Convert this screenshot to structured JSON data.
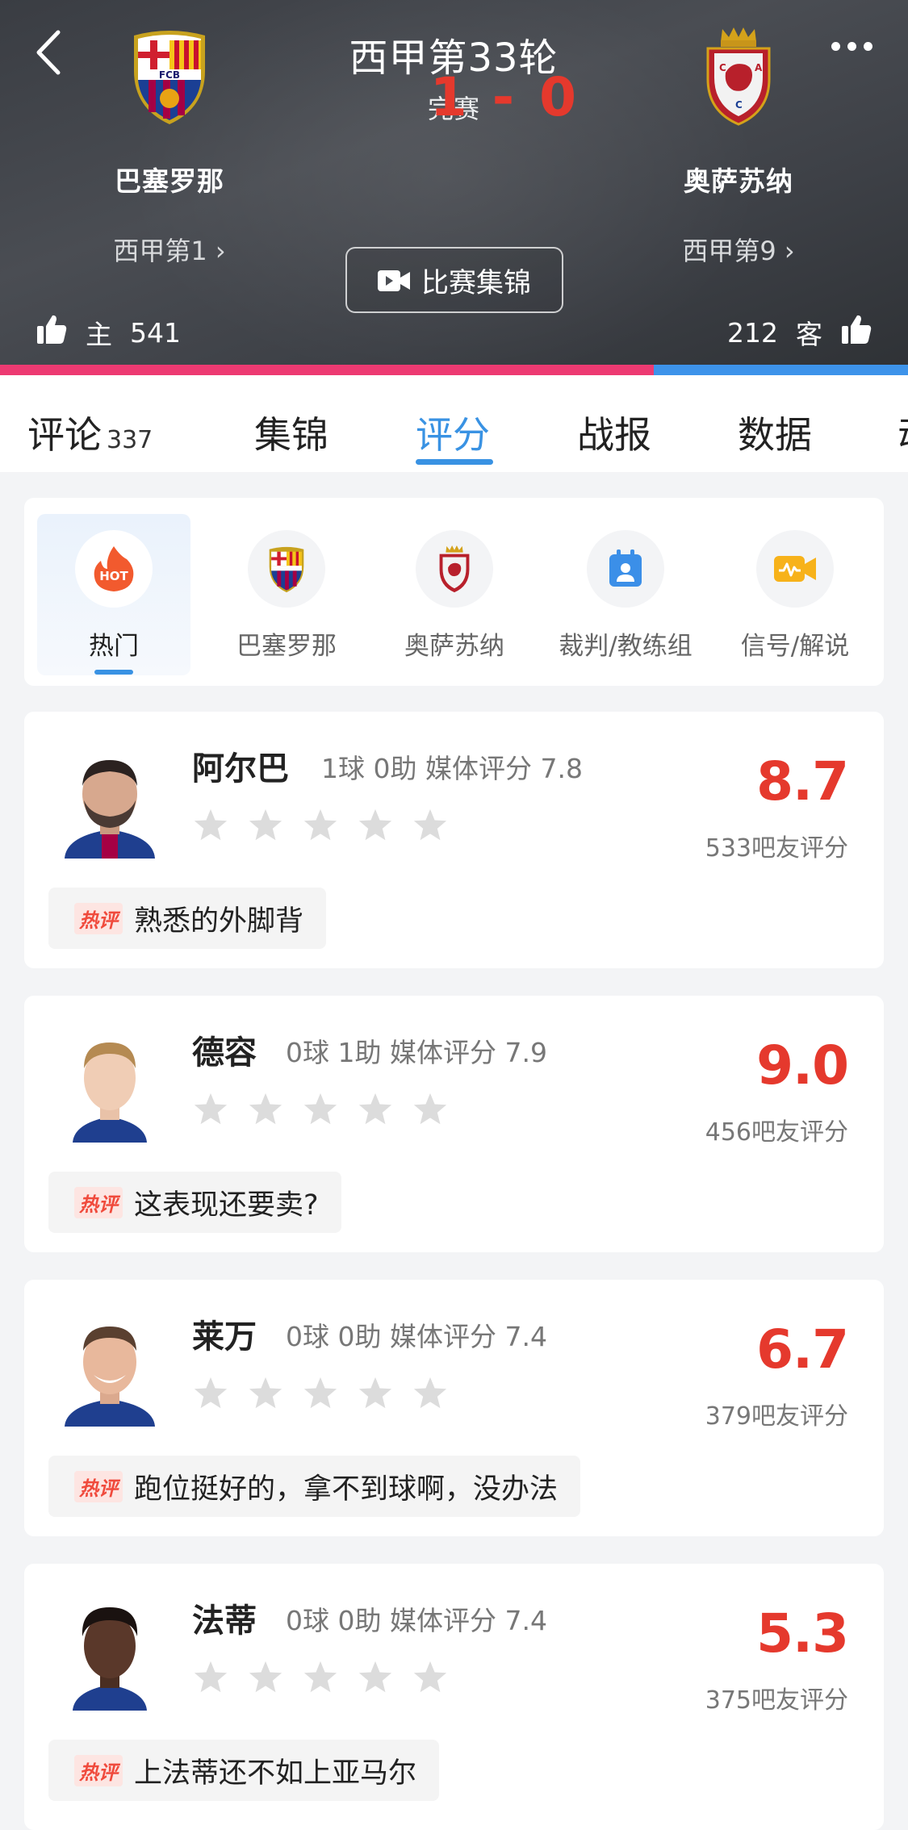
{
  "header": {
    "round": "西甲第33轮",
    "score": "1 - 0",
    "status": "完赛",
    "home": {
      "name": "巴塞罗那",
      "rank": "西甲第1",
      "votes": "541",
      "vote_label": "主"
    },
    "away": {
      "name": "奥萨苏纳",
      "rank": "西甲第9",
      "votes": "212",
      "vote_label": "客"
    },
    "highlights_label": "比赛集锦",
    "vote_split": {
      "home_fraction": 0.72
    },
    "colors": {
      "home_bar": "#ed3a72",
      "away_bar": "#3d93ea"
    }
  },
  "tabs": [
    {
      "label": "评论",
      "count": "337"
    },
    {
      "label": "集锦"
    },
    {
      "label": "评分",
      "active": true
    },
    {
      "label": "战报"
    },
    {
      "label": "数据"
    },
    {
      "label": "动"
    }
  ],
  "categories": [
    {
      "label": "热门",
      "icon": "hot-icon",
      "active": true,
      "badge": "HOT"
    },
    {
      "label": "巴塞罗那",
      "icon": "barcelona-crest-icon"
    },
    {
      "label": "奥萨苏纳",
      "icon": "osasuna-crest-icon"
    },
    {
      "label": "裁判/教练组",
      "icon": "referee-icon"
    },
    {
      "label": "信号/解说",
      "icon": "broadcast-icon"
    }
  ],
  "hot_tag": "热评",
  "players": [
    {
      "name": "阿尔巴",
      "stats": "1球 0助  媒体评分 7.8",
      "score": "8.7",
      "raters": "533吧友评分",
      "comment": "熟悉的外脚背"
    },
    {
      "name": "德容",
      "stats": "0球 1助  媒体评分 7.9",
      "score": "9.0",
      "raters": "456吧友评分",
      "comment": "这表现还要卖?"
    },
    {
      "name": "莱万",
      "stats": "0球 0助  媒体评分 7.4",
      "score": "6.7",
      "raters": "379吧友评分",
      "comment": "跑位挺好的，拿不到球啊，没办法"
    },
    {
      "name": "法蒂",
      "stats": "0球 0助  媒体评分 7.4",
      "score": "5.3",
      "raters": "375吧友评分",
      "comment": "上法蒂还不如上亚马尔"
    }
  ]
}
